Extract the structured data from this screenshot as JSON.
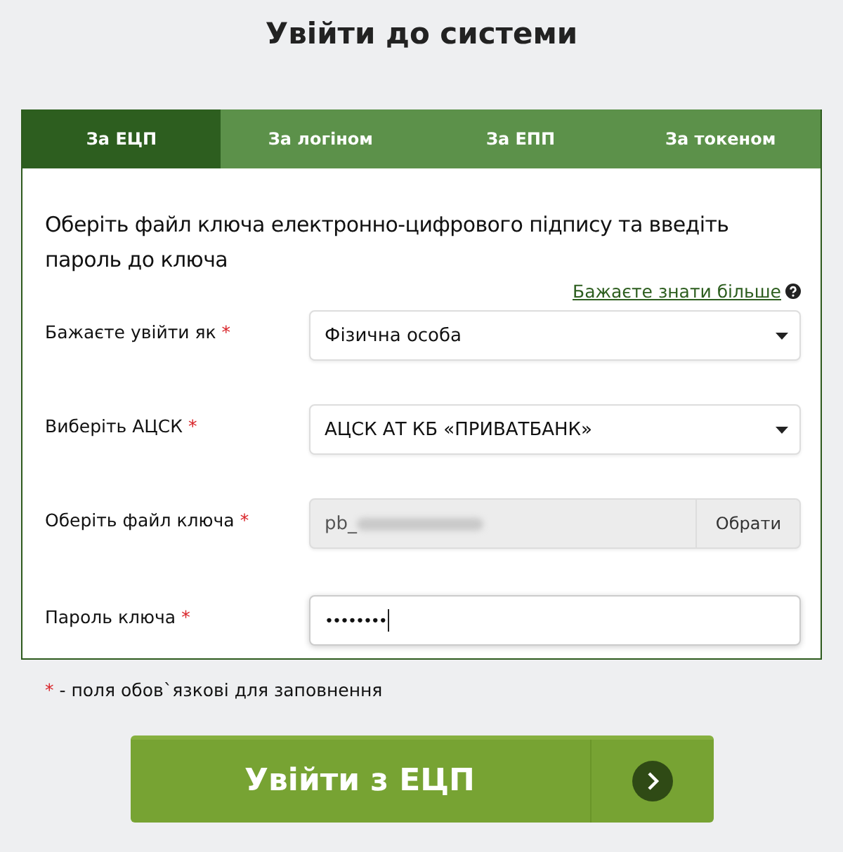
{
  "title": "Увійти до системи",
  "tabs": [
    {
      "label": "За ЕЦП",
      "selected": true
    },
    {
      "label": "За логіном",
      "selected": false
    },
    {
      "label": "За ЕПП",
      "selected": false
    },
    {
      "label": "За токеном",
      "selected": false
    }
  ],
  "instruction": "Оберіть файл ключа електронно-цифрового підпису та введіть пароль до ключа",
  "help_link": "Бажаєте знати більше",
  "fields": [
    {
      "kind": "select",
      "label": "Бажаєте увійти як",
      "required_mark": "*",
      "value": "Фізична особа"
    },
    {
      "kind": "select",
      "label": "Виберіть АЦСК",
      "required_mark": "*",
      "value": "АЦСК АТ КБ «ПРИВАТБАНК»"
    },
    {
      "kind": "file",
      "label": "Оберіть файл ключа",
      "required_mark": "*",
      "value": "pb_",
      "redacted": true,
      "button": "Обрати"
    },
    {
      "kind": "password",
      "label": "Пароль ключа",
      "required_mark": "*",
      "value": "••••••••",
      "focused": true
    }
  ],
  "footnote": {
    "mark": "*",
    "text": "- поля обов`язкові для заповнення"
  },
  "submit_button": "Увійти з ЕЦП"
}
